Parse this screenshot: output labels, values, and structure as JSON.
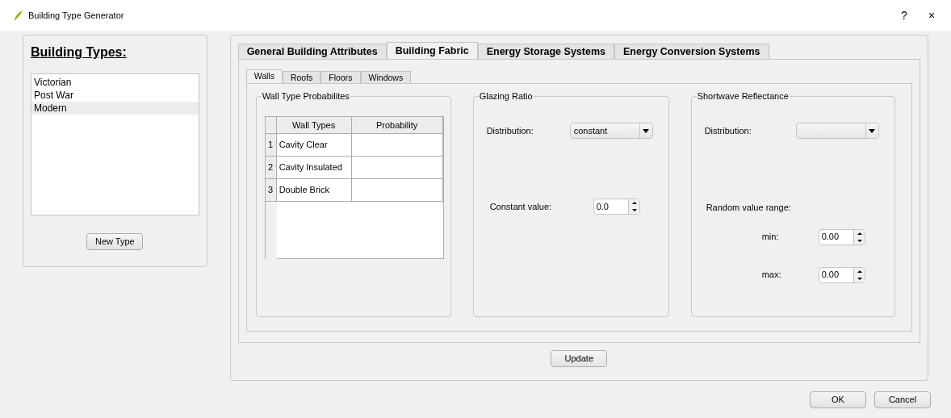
{
  "window": {
    "title": "Building Type Generator",
    "buttons": [
      "?",
      "×"
    ]
  },
  "building_types": {
    "heading": "Building Types:",
    "items": [
      {
        "label": "Victorian",
        "selected": false
      },
      {
        "label": "Post War",
        "selected": false
      },
      {
        "label": "Modern",
        "selected": true
      }
    ],
    "new_button": "New Type"
  },
  "tabs": [
    {
      "label": "General Building Attributes",
      "selected": false
    },
    {
      "label": "Building Fabric",
      "selected": true
    },
    {
      "label": "Energy Storage Systems",
      "selected": false
    },
    {
      "label": "Energy Conversion Systems",
      "selected": false
    }
  ],
  "sub_tabs": [
    {
      "label": "Walls",
      "selected": true
    },
    {
      "label": "Roofs",
      "selected": false
    },
    {
      "label": "Floors",
      "selected": false
    },
    {
      "label": "Windows",
      "selected": false
    }
  ],
  "wall_types": {
    "title": "Wall Type Probabilites",
    "columns": [
      "Wall Types",
      "Probability"
    ],
    "rows": [
      {
        "index": "1",
        "type": "Cavity Clear"
      },
      {
        "index": "2",
        "type": "Cavity Insulated"
      },
      {
        "index": "3",
        "type": "Double Brick"
      }
    ]
  },
  "glazing": {
    "title": "Glazing Ratio",
    "distribution_label": "Distribution:",
    "distribution": "constant",
    "constant_label": "Constant value:",
    "constant_value": "0.0"
  },
  "shortwave": {
    "title": "Shortwave Reflectance",
    "distribution_label": "Distribution:",
    "range_label": "Random value range:",
    "min_label": "min:",
    "min_value": "0.00",
    "max_label": "max:",
    "max_value": "0.00"
  },
  "update_button": "Update",
  "dialog_buttons": [
    "OK",
    "Cancel"
  ]
}
